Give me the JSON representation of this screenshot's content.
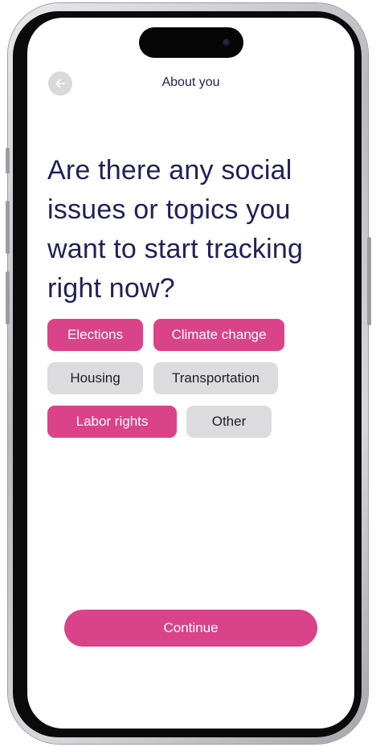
{
  "header": {
    "title": "About you"
  },
  "question": "Are there any social issues or topics you want to start tracking right now?",
  "topics": [
    {
      "label": "Elections",
      "selected": true
    },
    {
      "label": "Climate change",
      "selected": true
    },
    {
      "label": "Housing",
      "selected": false
    },
    {
      "label": "Transportation",
      "selected": false
    },
    {
      "label": "Labor rights",
      "selected": true
    },
    {
      "label": "Other",
      "selected": false
    }
  ],
  "continue_label": "Continue",
  "colors": {
    "accent": "#da4389",
    "heading": "#202158",
    "chip_inactive": "#dcdcde"
  }
}
